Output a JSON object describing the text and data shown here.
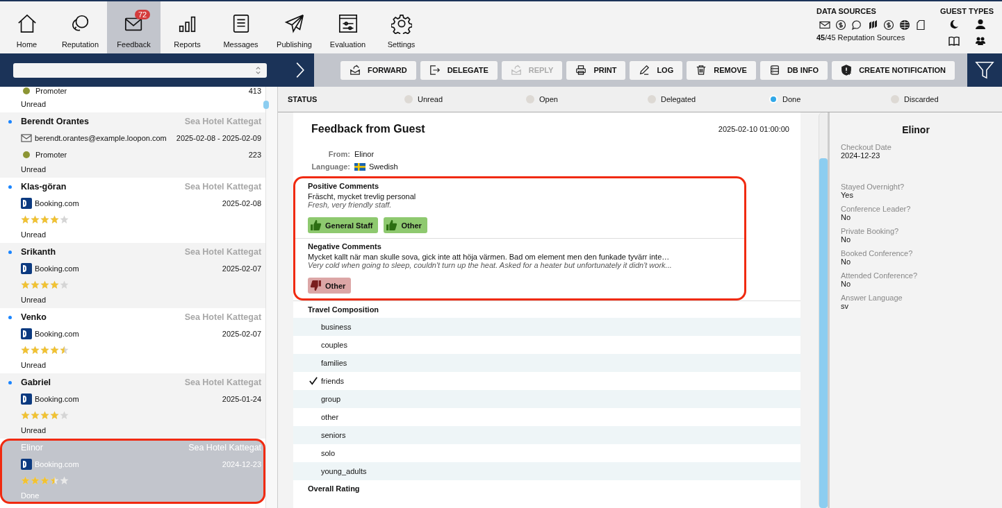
{
  "nav": {
    "items": [
      {
        "label": "Home",
        "selected": false
      },
      {
        "label": "Reputation",
        "selected": false
      },
      {
        "label": "Feedback",
        "selected": true,
        "badge": "72"
      },
      {
        "label": "Reports",
        "selected": false
      },
      {
        "label": "Messages",
        "selected": false
      },
      {
        "label": "Publishing",
        "selected": false
      },
      {
        "label": "Evaluation",
        "selected": false
      },
      {
        "label": "Settings",
        "selected": false
      }
    ],
    "data_sources": {
      "title": "DATA SOURCES",
      "summary": "**45**/45 Reputation Sources"
    },
    "guest_types": {
      "title": "GUEST TYPES"
    }
  },
  "toolbar": {
    "buttons": [
      {
        "label": "FORWARD",
        "disabled": false
      },
      {
        "label": "DELEGATE",
        "disabled": false
      },
      {
        "label": "REPLY",
        "disabled": true
      },
      {
        "label": "PRINT",
        "disabled": false
      },
      {
        "label": "LOG",
        "disabled": false
      },
      {
        "label": "REMOVE",
        "disabled": false
      },
      {
        "label": "DB INFO",
        "disabled": false
      },
      {
        "label": "CREATE NOTIFICATION",
        "disabled": false
      }
    ]
  },
  "feedback_list": [
    {
      "sentiment": {
        "label": "Promoter",
        "color": "#8c9534",
        "count": "413"
      },
      "status": "Unread",
      "selected": false,
      "highlighted": false
    },
    {
      "name": "Berendt Orantes",
      "unread": true,
      "hotel": "Sea Hotel Kattegat",
      "source": {
        "kind": "email",
        "text": "berendt.orantes@example.loopon.com"
      },
      "date": "2025-02-08 - 2025-02-09",
      "sentiment": {
        "label": "Promoter",
        "color": "#8c9534",
        "count": "223"
      },
      "status": "Unread",
      "selected": false,
      "highlighted": false
    },
    {
      "name": "Klas-göran",
      "unread": true,
      "hotel": "Sea Hotel Kattegat",
      "source": {
        "kind": "booking",
        "text": "Booking.com"
      },
      "date": "2025-02-08",
      "stars": 4,
      "status": "Unread",
      "selected": false,
      "highlighted": false
    },
    {
      "name": "Srikanth",
      "unread": true,
      "hotel": "Sea Hotel Kattegat",
      "source": {
        "kind": "booking",
        "text": "Booking.com"
      },
      "date": "2025-02-07",
      "stars": 4,
      "status": "Unread",
      "selected": false,
      "highlighted": false
    },
    {
      "name": "Venko",
      "unread": true,
      "hotel": "Sea Hotel Kattegat",
      "source": {
        "kind": "booking",
        "text": "Booking.com"
      },
      "date": "2025-02-07",
      "stars": 4.5,
      "status": "Unread",
      "selected": false,
      "highlighted": false
    },
    {
      "name": "Gabriel",
      "unread": true,
      "hotel": "Sea Hotel Kattegat",
      "source": {
        "kind": "booking",
        "text": "Booking.com"
      },
      "date": "2025-01-24",
      "stars": 4,
      "status": "Unread",
      "selected": false,
      "highlighted": false
    },
    {
      "name": "Elinor",
      "unread": false,
      "hotel": "Sea Hotel Kattegat",
      "source": {
        "kind": "booking",
        "text": "Booking.com"
      },
      "date": "2024-12-23",
      "stars": 3.5,
      "status": "Done",
      "selected": true,
      "highlighted": true
    }
  ],
  "status": {
    "label": "STATUS",
    "options": [
      {
        "label": "Unread",
        "selected": false
      },
      {
        "label": "Open",
        "selected": false
      },
      {
        "label": "Delegated",
        "selected": false
      },
      {
        "label": "Done",
        "selected": true
      },
      {
        "label": "Discarded",
        "selected": false
      }
    ]
  },
  "feedback": {
    "title": "Feedback from Guest",
    "datetime": "2025-02-10 01:00:00",
    "from": {
      "label": "From:",
      "value": "Elinor"
    },
    "language": {
      "label": "Language:",
      "value": "Swedish"
    },
    "comments_highlighted": true,
    "comments": [
      {
        "title": "Positive Comments",
        "kind": "positive",
        "original": "Fräscht, mycket trevlig personal",
        "translation": "Fresh, very friendly staff.",
        "tags": [
          "General Staff",
          "Other"
        ]
      },
      {
        "title": "Negative Comments",
        "kind": "negative",
        "original": "Mycket kallt när man skulle sova, gick inte att höja värmen. Bad om element men den funkade tyvärr inte…",
        "translation": "Very cold when going to sleep, couldn't turn up the heat. Asked for a heater but unfortunately it didn't work...",
        "tags": [
          "Other"
        ]
      }
    ],
    "travel_composition": {
      "title": "Travel Composition",
      "options": [
        {
          "label": "business",
          "checked": false
        },
        {
          "label": "couples",
          "checked": false
        },
        {
          "label": "families",
          "checked": false
        },
        {
          "label": "friends",
          "checked": true
        },
        {
          "label": "group",
          "checked": false
        },
        {
          "label": "other",
          "checked": false
        },
        {
          "label": "seniors",
          "checked": false
        },
        {
          "label": "solo",
          "checked": false
        },
        {
          "label": "young_adults",
          "checked": false
        }
      ]
    },
    "next_section": "Overall Rating"
  },
  "guest_panel": {
    "name": "Elinor",
    "fields": [
      {
        "label": "Checkout Date",
        "value": "2024-12-23"
      },
      {
        "label": "Stayed Overnight?",
        "value": "Yes"
      },
      {
        "label": "Conference Leader?",
        "value": "No"
      },
      {
        "label": "Private Booking?",
        "value": "No"
      },
      {
        "label": "Booked Conference?",
        "value": "No"
      },
      {
        "label": "Attended Conference?",
        "value": "No"
      },
      {
        "label": "Answer Language",
        "value": "sv"
      }
    ]
  }
}
